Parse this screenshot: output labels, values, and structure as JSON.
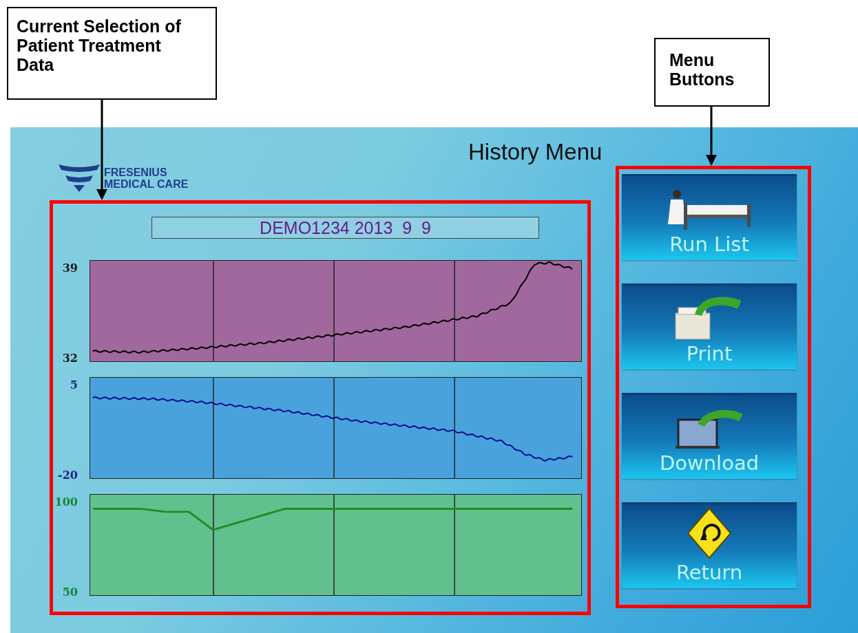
{
  "annotations": [
    {
      "text": "Current Selection of Patient Treatment Data"
    },
    {
      "text": "Menu Buttons"
    }
  ],
  "screen": {
    "title": "History Menu",
    "logo": {
      "line_1": "FRESENIUS",
      "line_2": "MEDICAL CARE"
    },
    "patient_banner": "DEMO1234 2013  9  9",
    "charts": [
      {
        "y_max": "39",
        "y_min": "32",
        "color": "#000000"
      },
      {
        "y_max": "5",
        "y_min": "-20",
        "color": "#0a0a8c"
      },
      {
        "y_max": "100",
        "y_min": "50",
        "color": "#1f8f1f"
      }
    ],
    "buttons": [
      {
        "label": "Run List",
        "kind": "bed"
      },
      {
        "label": "Print",
        "kind": "printer"
      },
      {
        "label": "Download",
        "kind": "laptop"
      },
      {
        "label": "Return",
        "kind": "sign"
      }
    ]
  }
}
